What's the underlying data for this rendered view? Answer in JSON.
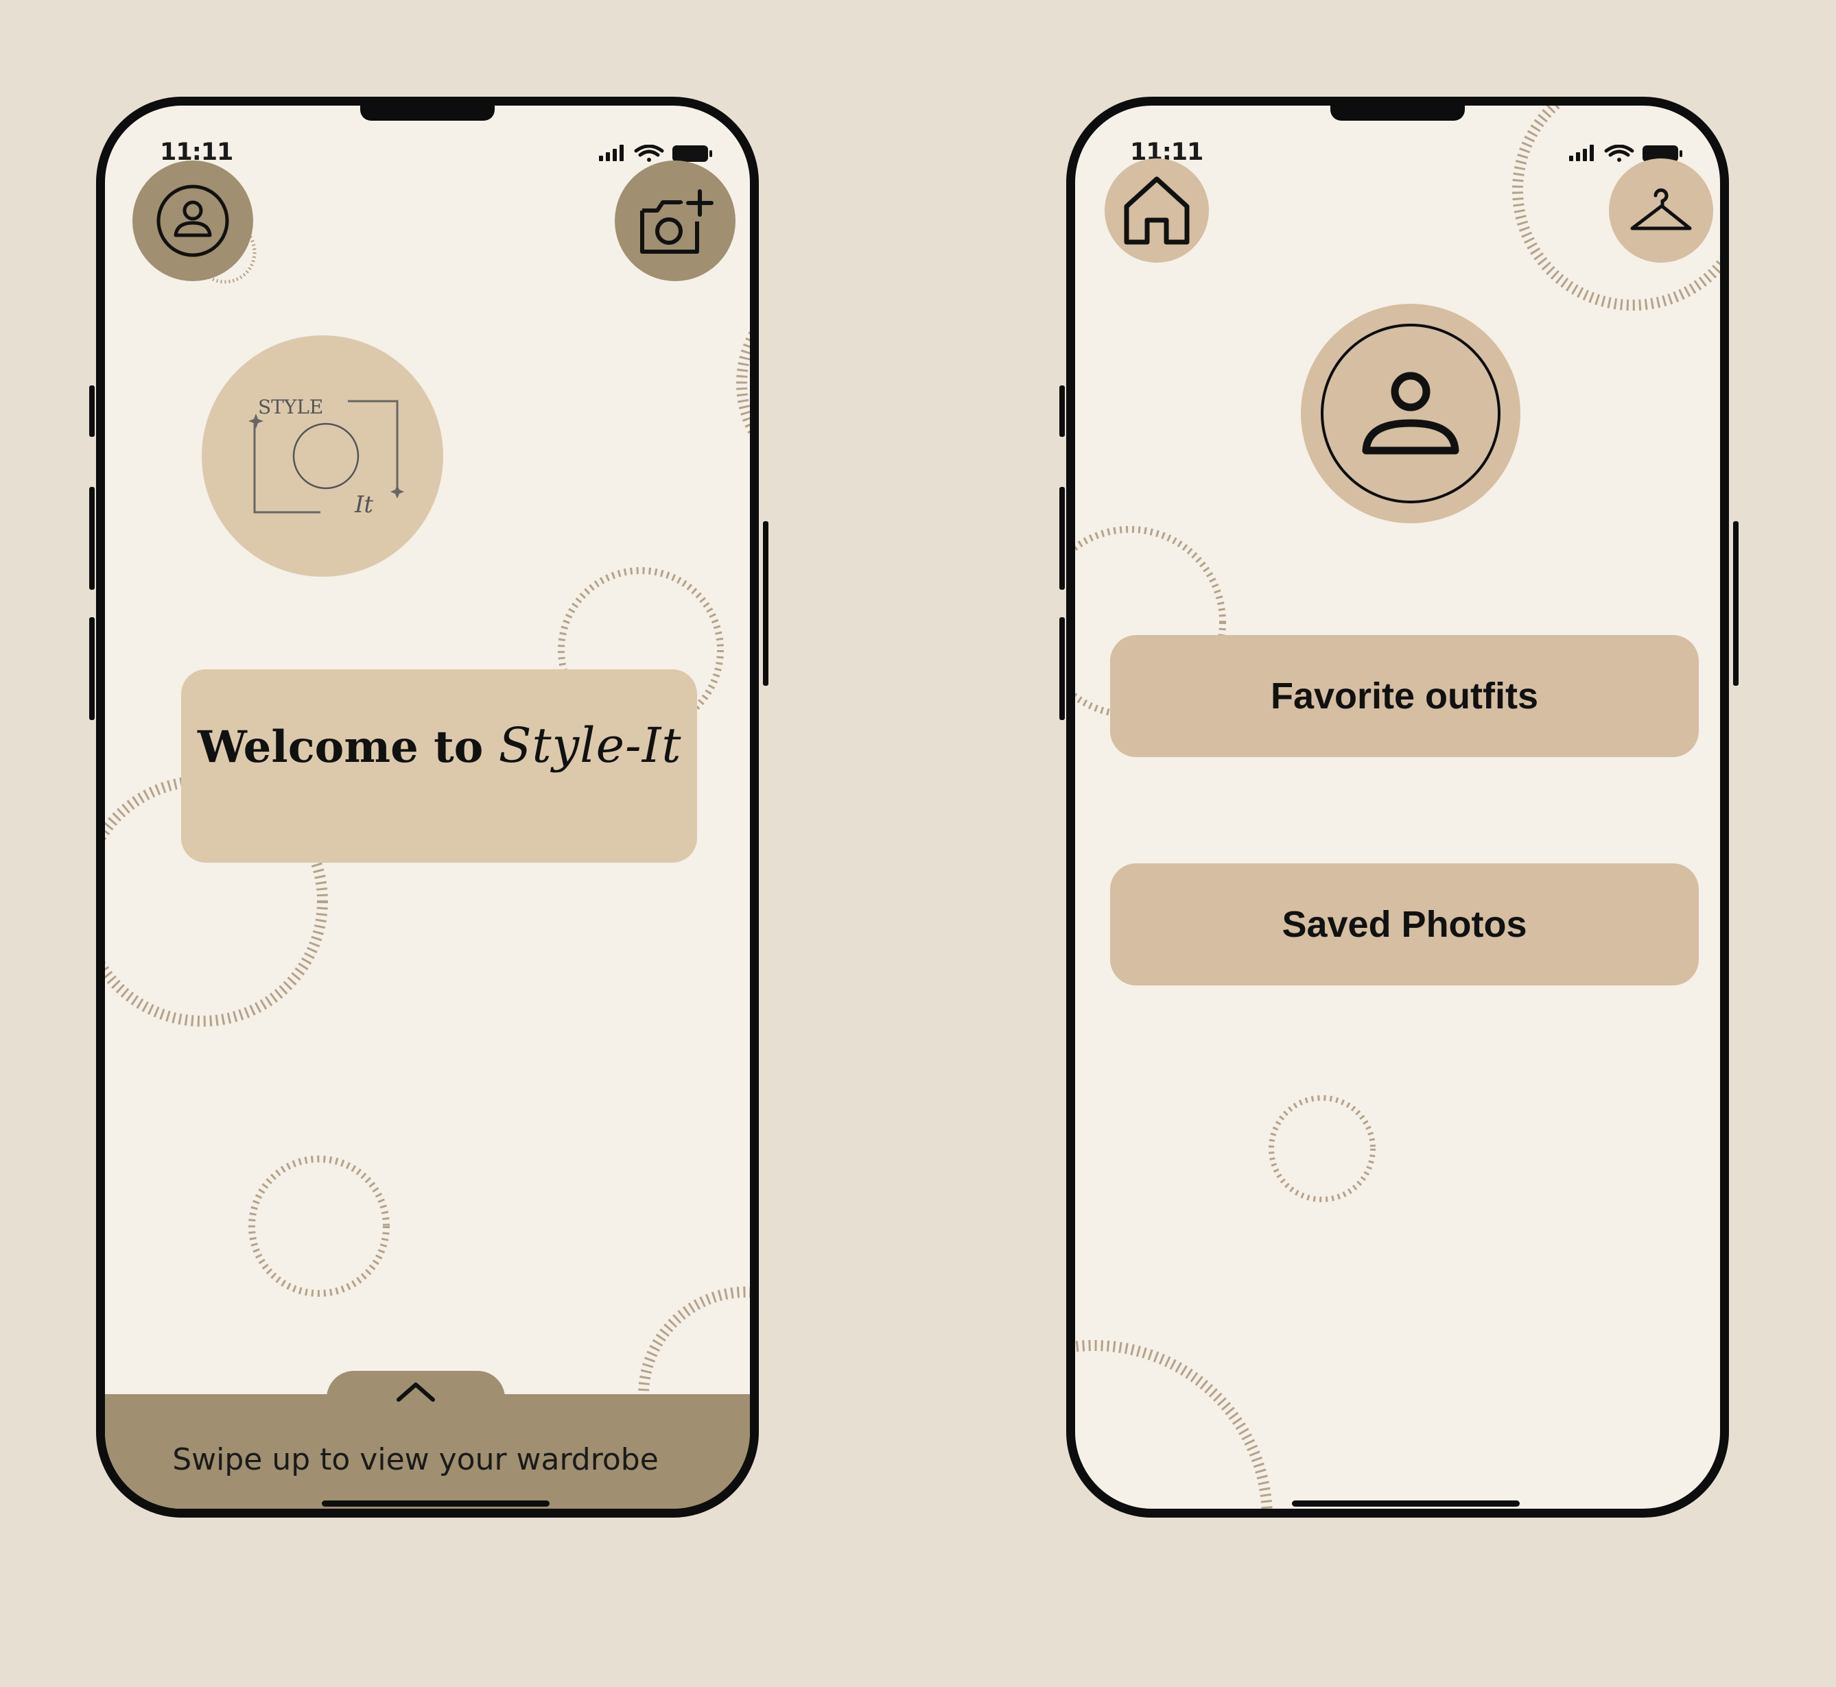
{
  "colors": {
    "background": "#e8dfd3",
    "screen": "#f5f0e8",
    "accent_dark": "#a08f70",
    "accent_light": "#dcc9ac",
    "button": "#d5bea1"
  },
  "home_screen": {
    "status_time": "11:11",
    "profile_icon": "user-icon",
    "camera_icon": "camera-add-icon",
    "logo": {
      "top_word": "STYLE",
      "bottom_word": "It"
    },
    "welcome_prefix": "Welcome to ",
    "welcome_brand": "Style-It",
    "swipe_icon": "chevron-up-icon",
    "swipe_hint": "Swipe up to view your wardrobe"
  },
  "profile_screen": {
    "status_time": "11:11",
    "home_icon": "home-icon",
    "wardrobe_icon": "hanger-icon",
    "avatar_icon": "user-icon",
    "buttons": [
      {
        "label": "Favorite outfits"
      },
      {
        "label": "Saved Photos"
      }
    ]
  }
}
